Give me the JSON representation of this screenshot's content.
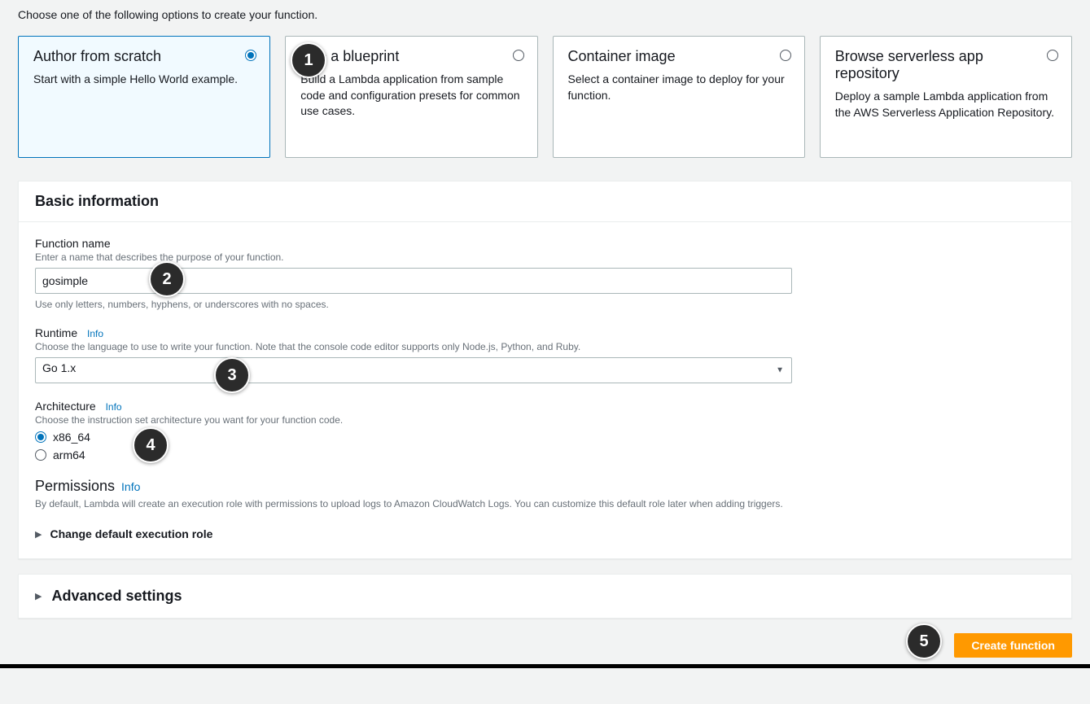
{
  "intro": "Choose one of the following options to create your function.",
  "options": [
    {
      "title": "Author from scratch",
      "desc": "Start with a simple Hello World example.",
      "selected": true
    },
    {
      "title": "Use a blueprint",
      "desc": "Build a Lambda application from sample code and configuration presets for common use cases.",
      "selected": false
    },
    {
      "title": "Container image",
      "desc": "Select a container image to deploy for your function.",
      "selected": false
    },
    {
      "title": "Browse serverless app repository",
      "desc": "Deploy a sample Lambda application from the AWS Serverless Application Repository.",
      "selected": false
    }
  ],
  "basic_info": {
    "heading": "Basic information",
    "function_name": {
      "label": "Function name",
      "hint": "Enter a name that describes the purpose of your function.",
      "value": "gosimple",
      "below_hint": "Use only letters, numbers, hyphens, or underscores with no spaces."
    },
    "runtime": {
      "label": "Runtime",
      "info": "Info",
      "hint": "Choose the language to use to write your function. Note that the console code editor supports only Node.js, Python, and Ruby.",
      "value": "Go 1.x"
    },
    "architecture": {
      "label": "Architecture",
      "info": "Info",
      "hint": "Choose the instruction set architecture you want for your function code.",
      "options": [
        {
          "label": "x86_64",
          "checked": true
        },
        {
          "label": "arm64",
          "checked": false
        }
      ]
    },
    "permissions": {
      "heading": "Permissions",
      "info": "Info",
      "desc": "By default, Lambda will create an execution role with permissions to upload logs to Amazon CloudWatch Logs. You can customize this default role later when adding triggers."
    },
    "change_role": "Change default execution role"
  },
  "advanced": {
    "title": "Advanced settings"
  },
  "footer": {
    "create_button": "Create function"
  },
  "steps": {
    "s1": "1",
    "s2": "2",
    "s3": "3",
    "s4": "4",
    "s5": "5"
  }
}
